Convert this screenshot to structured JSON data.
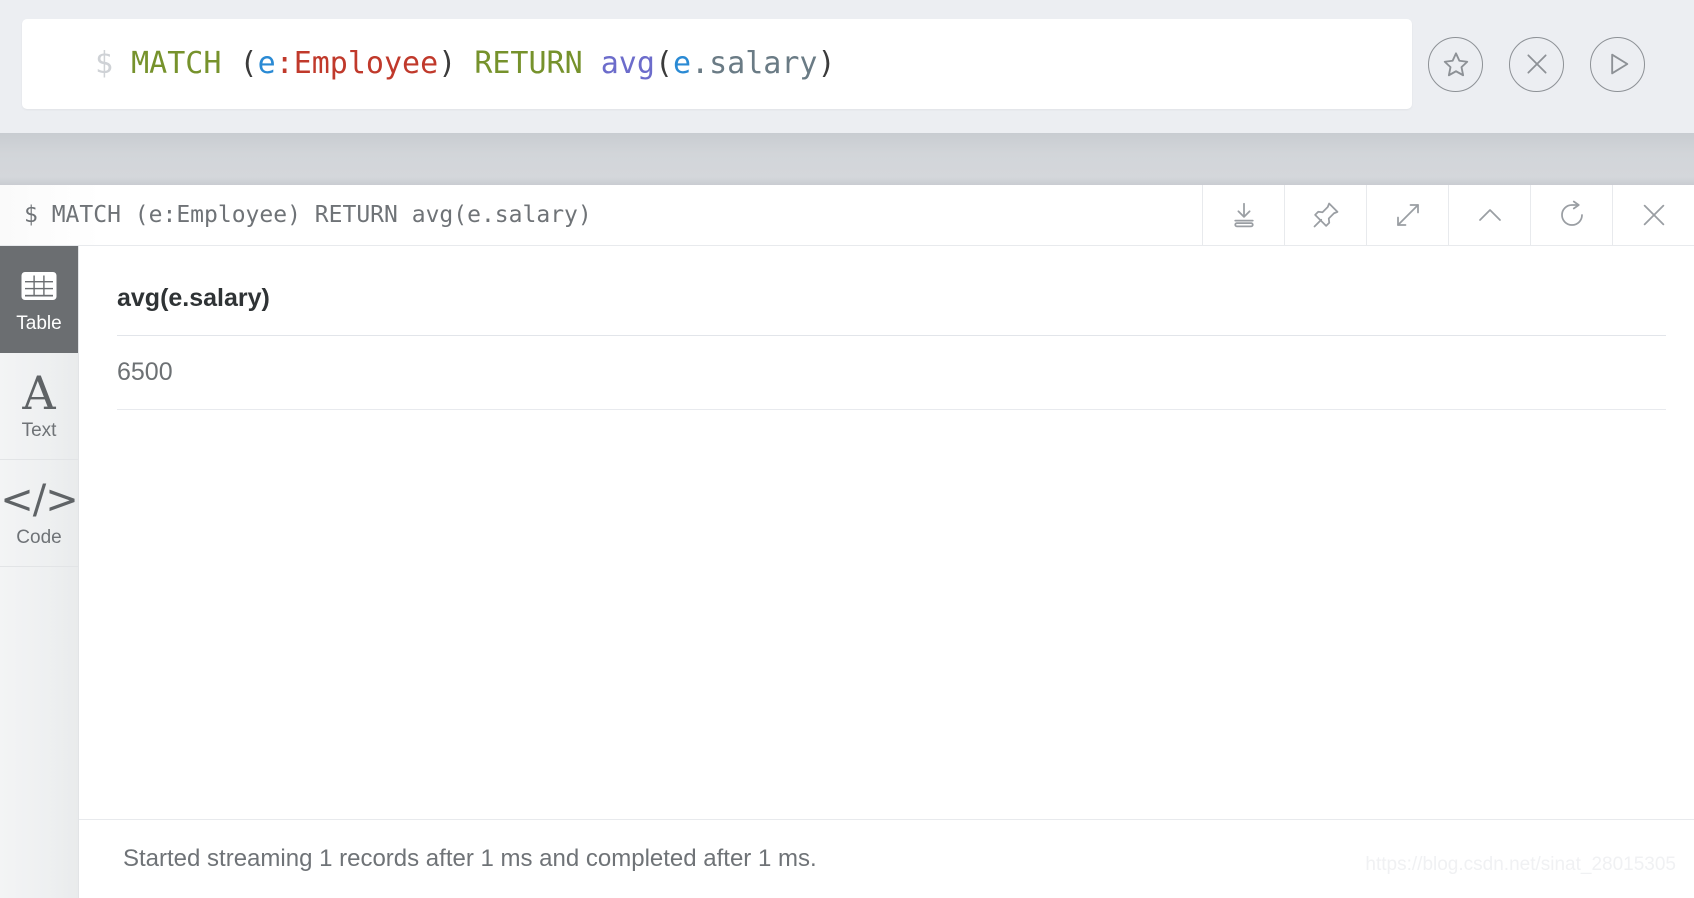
{
  "editor": {
    "prompt": "$",
    "query": "MATCH (e:Employee) RETURN avg(e.salary)",
    "tokens": [
      {
        "text": "$",
        "kind": "prompt"
      },
      {
        "text": " ",
        "kind": "plain"
      },
      {
        "text": "MATCH",
        "kind": "kw"
      },
      {
        "text": " ",
        "kind": "plain"
      },
      {
        "text": "(",
        "kind": "paren"
      },
      {
        "text": "e",
        "kind": "var"
      },
      {
        "text": ":",
        "kind": "colon"
      },
      {
        "text": "Employee",
        "kind": "label"
      },
      {
        "text": ")",
        "kind": "paren"
      },
      {
        "text": " ",
        "kind": "plain"
      },
      {
        "text": "RETURN",
        "kind": "kw"
      },
      {
        "text": " ",
        "kind": "plain"
      },
      {
        "text": "avg",
        "kind": "fn"
      },
      {
        "text": "(",
        "kind": "paren"
      },
      {
        "text": "e",
        "kind": "var"
      },
      {
        "text": ".salary",
        "kind": "prop"
      },
      {
        "text": ")",
        "kind": "paren"
      }
    ],
    "actions": [
      {
        "name": "favorite-button",
        "icon": "star-circle-icon",
        "label": "Favorite"
      },
      {
        "name": "clear-button",
        "icon": "close-circle-icon",
        "label": "Clear"
      },
      {
        "name": "run-button",
        "icon": "play-circle-icon",
        "label": "Run"
      }
    ]
  },
  "frame": {
    "title": "$ MATCH (e:Employee) RETURN avg(e.salary)",
    "tools": [
      {
        "name": "download-button",
        "icon": "download-icon",
        "label": "Download"
      },
      {
        "name": "pin-button",
        "icon": "pin-icon",
        "label": "Pin"
      },
      {
        "name": "expand-button",
        "icon": "expand-icon",
        "label": "Fullscreen"
      },
      {
        "name": "collapse-button",
        "icon": "chevron-up-icon",
        "label": "Collapse"
      },
      {
        "name": "rerun-button",
        "icon": "refresh-icon",
        "label": "Rerun"
      },
      {
        "name": "close-button",
        "icon": "close-icon",
        "label": "Close"
      }
    ]
  },
  "view_tabs": [
    {
      "id": "table",
      "label": "Table",
      "icon": "table-grid-icon",
      "active": true
    },
    {
      "id": "text",
      "label": "Text",
      "icon": "letter-a-icon",
      "active": false
    },
    {
      "id": "code",
      "label": "Code",
      "icon": "angle-brackets-icon",
      "active": false
    }
  ],
  "result": {
    "columns": [
      "avg(e.salary)"
    ],
    "rows": [
      [
        "6500"
      ]
    ]
  },
  "status": {
    "message": "Started streaming 1 records after 1 ms and completed after 1 ms."
  },
  "watermark": {
    "text": "https://blog.csdn.net/sinat_28015305"
  },
  "colors": {
    "page_background": "#eceef2",
    "stream_band": "#d2d5d9",
    "frame_background": "#ffffff",
    "active_tab": "#6b6e71",
    "keyword": "#76922c",
    "label": "#c0392b",
    "variable": "#2a8ad4",
    "function": "#6c6ccb",
    "property": "#6a7b85",
    "prompt": "#cfd2d6",
    "muted_text": "#6f7377"
  }
}
